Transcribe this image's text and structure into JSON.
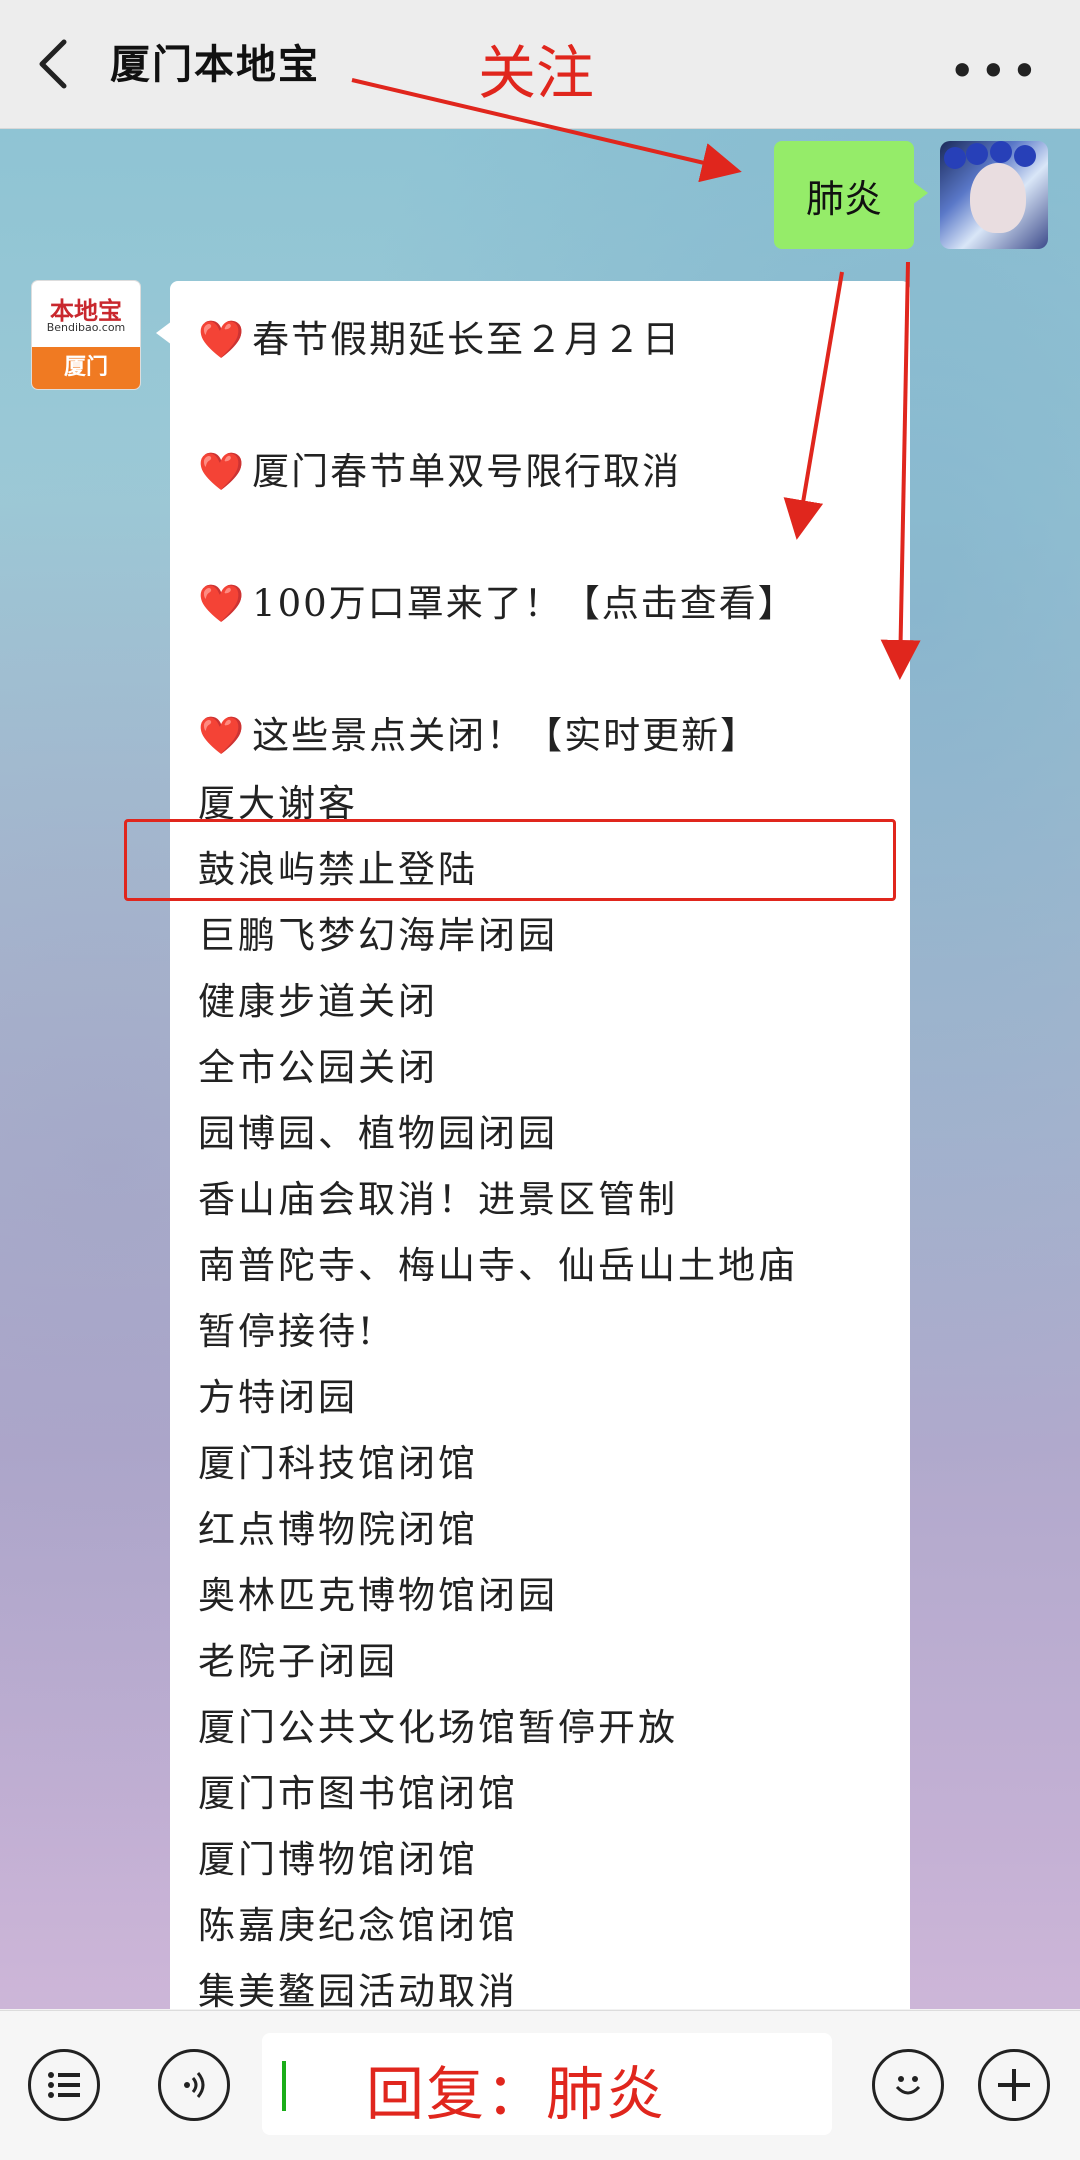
{
  "header": {
    "title": "厦门本地宝",
    "more_label": "•••",
    "annotation_follow": "关注"
  },
  "chat": {
    "my_message": "肺炎",
    "bot_avatar": {
      "brand": "本地宝",
      "domain": "Bendibao.com",
      "city": "厦门"
    },
    "headlines": [
      {
        "heart": "❤️",
        "text": "春节假期延长至２月２日"
      },
      {
        "heart": "❤️",
        "text": "厦门春节单双号限行取消"
      },
      {
        "heart": "❤️",
        "text": "100万口罩来了！【点击查看】"
      },
      {
        "heart": "❤️",
        "text": "这些景点关闭！【实时更新】"
      }
    ],
    "closures": [
      "厦大谢客",
      "鼓浪屿禁止登陆",
      "巨鹏飞梦幻海岸闭园",
      "健康步道关闭",
      "全市公园关闭",
      "园博园、植物园闭园",
      "香山庙会取消！进景区管制",
      "南普陀寺、梅山寺、仙岳山土地庙",
      "暂停接待!",
      "方特闭园",
      "厦门科技馆闭馆",
      "红点博物院闭馆",
      "奥林匹克博物馆闭园",
      "老院子闭园",
      "厦门公共文化场馆暂停开放",
      "厦门市图书馆闭馆",
      "厦门博物馆闭馆",
      "陈嘉庚纪念馆闭馆",
      "集美鳌园活动取消"
    ]
  },
  "composer": {
    "reply_annotation": "回复：肺炎"
  },
  "colors": {
    "annotation_red": "#e0261d",
    "my_bubble": "#95ec69",
    "heart": "#d8222a"
  },
  "icons": [
    "back-chevron-icon",
    "more-icon",
    "menu-list-icon",
    "voice-icon",
    "emoji-icon",
    "plus-icon"
  ]
}
